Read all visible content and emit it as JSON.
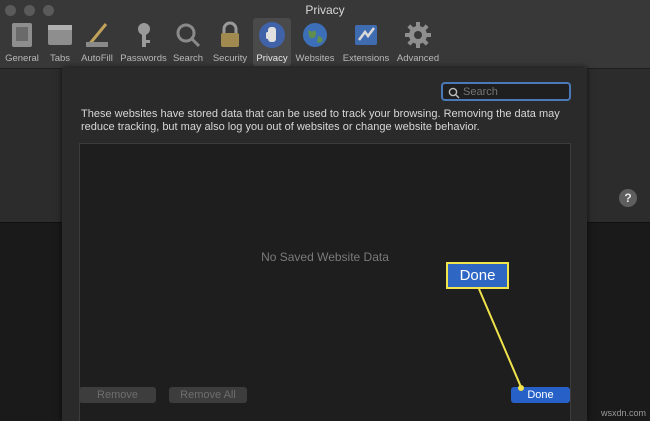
{
  "window": {
    "title": "Privacy"
  },
  "toolbar": {
    "items": [
      {
        "label": "General",
        "icon": "general-icon"
      },
      {
        "label": "Tabs",
        "icon": "tabs-icon"
      },
      {
        "label": "AutoFill",
        "icon": "autofill-icon"
      },
      {
        "label": "Passwords",
        "icon": "key-icon"
      },
      {
        "label": "Search",
        "icon": "magnifier-icon"
      },
      {
        "label": "Security",
        "icon": "lock-icon"
      },
      {
        "label": "Privacy",
        "icon": "hand-icon",
        "selected": true
      },
      {
        "label": "Websites",
        "icon": "globe-icon"
      },
      {
        "label": "Extensions",
        "icon": "puzzle-icon"
      },
      {
        "label": "Advanced",
        "icon": "gear-icon"
      }
    ]
  },
  "help": {
    "label": "?"
  },
  "sheet": {
    "search_placeholder": "Search",
    "description": "These websites have stored data that can be used to track your browsing. Removing the data may reduce tracking, but may also log you out of websites or change website behavior.",
    "empty_message": "No Saved Website Data",
    "remove_label": "Remove",
    "remove_all_label": "Remove All",
    "done_label": "Done"
  },
  "callout": {
    "label": "Done",
    "border_color": "#f0e34b",
    "fill_color": "#2e66c4"
  },
  "watermark": "wsxdn.com",
  "colors": {
    "accent": "#2761c7",
    "search_focus": "#4b78b7"
  }
}
